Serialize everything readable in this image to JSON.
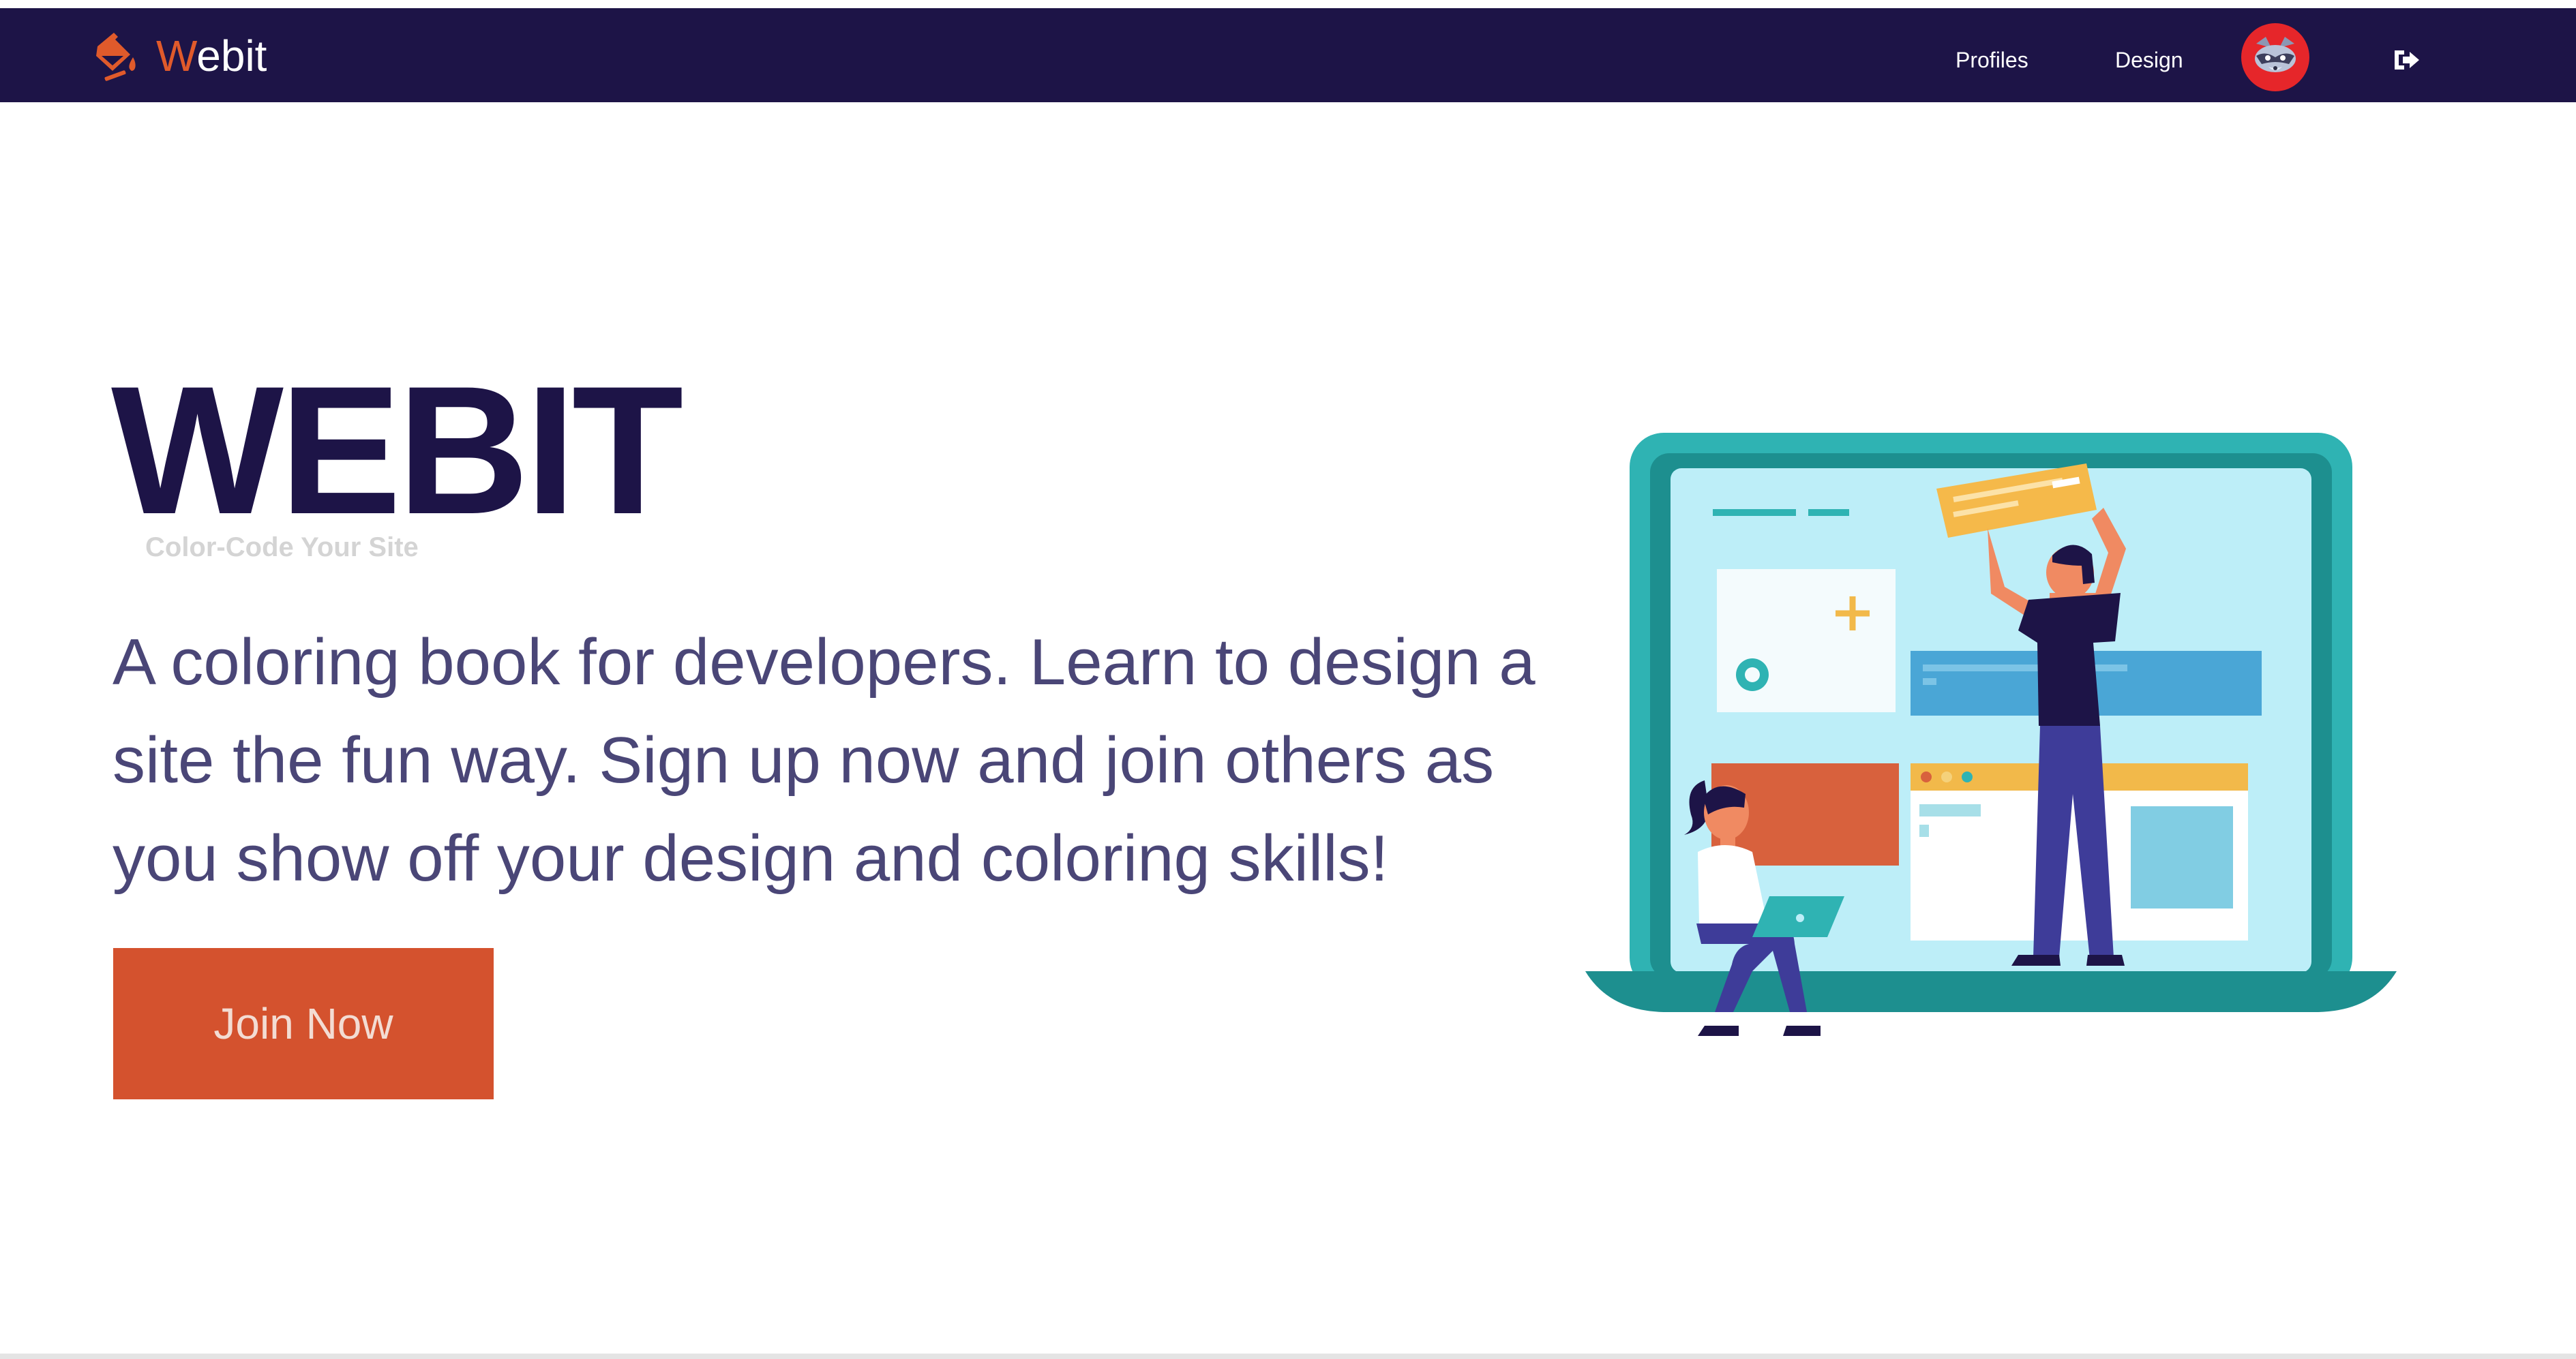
{
  "navbar": {
    "brand_letter": "W",
    "brand_rest": "ebit",
    "links": [
      {
        "label": "Profiles"
      },
      {
        "label": "Design"
      }
    ],
    "brand_icon": "paint-bucket-icon",
    "logout_icon": "sign-out-icon",
    "avatar_icon": "raccoon-avatar"
  },
  "hero": {
    "title": "WEBIT",
    "tagline": "Color-Code Your Site",
    "description": "A coloring book for developers. Learn to design a site the fun way. Sign up now and join others as you show off your design and coloring skills!",
    "cta_label": "Join Now",
    "illustration": "people-designing-website-on-laptop-illustration"
  },
  "colors": {
    "nav_bg": "#1d1447",
    "brand_accent": "#e05a2b",
    "title": "#1d1447",
    "description": "#4a4677",
    "cta_bg": "#d4522e",
    "avatar_bg": "#e6262a",
    "laptop": "#2fb3b3",
    "screen": "#bdeef8"
  }
}
